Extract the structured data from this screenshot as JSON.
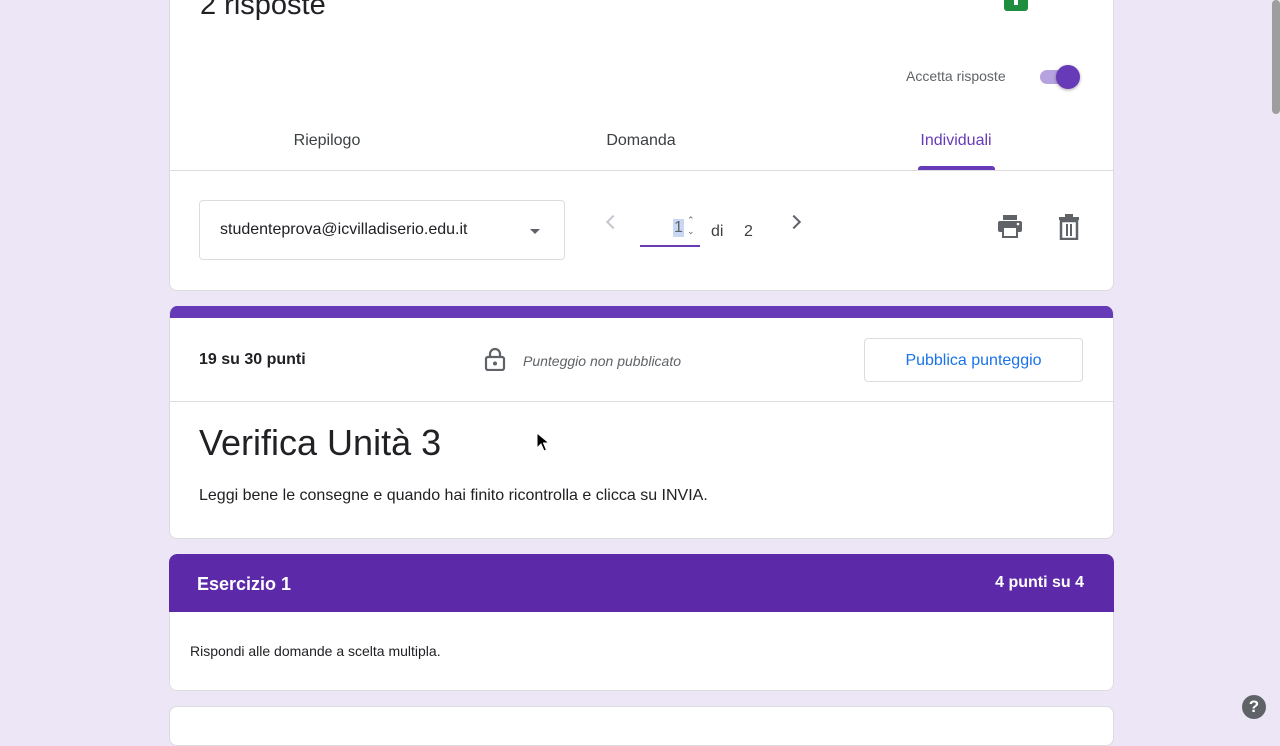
{
  "header": {
    "responses_title": "2 risposte",
    "accept_responses_label": "Accetta risposte",
    "accept_responses_on": true
  },
  "tabs": [
    {
      "label": "Riepilogo"
    },
    {
      "label": "Domanda"
    },
    {
      "label": "Individuali",
      "active": true
    }
  ],
  "navigator": {
    "respondent": "studenteprova@icvilladiserio.edu.it",
    "current_page": "1",
    "of_label": "di",
    "total_pages": "2"
  },
  "score_card": {
    "score": "19 su 30 punti",
    "status": "Punteggio non pubblicato",
    "publish_button": "Pubblica punteggio"
  },
  "form": {
    "title": "Verifica Unità 3",
    "description": "Leggi bene le consegne e quando hai finito ricontrolla e clicca su INVIA."
  },
  "section": {
    "title": "Esercizio 1",
    "points": "4 punti su 4",
    "description": "Rispondi alle domande a scelta multipla."
  },
  "help": {
    "symbol": "?"
  },
  "colors": {
    "accent": "#673ab7",
    "section_header": "#5c2aa8",
    "link_blue": "#1a73e8",
    "background": "#ede6f6"
  }
}
